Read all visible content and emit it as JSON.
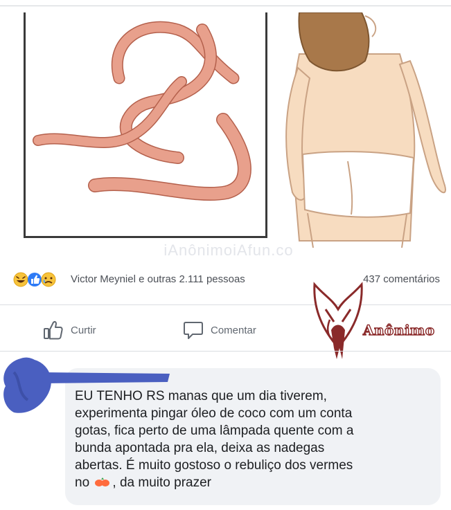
{
  "post": {
    "watermark": "iAnônimoiAfun.co"
  },
  "reactions": {
    "icons": [
      "haha-icon",
      "like-icon",
      "sad-icon"
    ],
    "names_text": "Victor Meyniel e outras 2.111 pessoas",
    "comments_text": "437 comentários"
  },
  "actions": {
    "like_label": "Curtir",
    "comment_label": "Comentar"
  },
  "badge": {
    "text": "Anônimo"
  },
  "comment": {
    "line1": "EU TENHO RS manas que um dia tiverem,",
    "line2": "experimenta pingar óleo de coco com um conta",
    "line3": "gotas, fica perto de uma lâmpada quente com a",
    "line4": "bunda apontada pra ela, deixa as nadegas",
    "line5": "abertas. É muito gostoso o rebuliço dos vermes",
    "line6_start": "no",
    "line6_end": ", da muito prazer"
  },
  "colors": {
    "worm": "#e8a08c",
    "worm_outline": "#b4604c",
    "skin": "#f7dcc0",
    "hair": "#a8784a",
    "scribble": "#4a5fc0",
    "badge_red": "#8a2a2a",
    "bubble": "#f0f2f5"
  }
}
